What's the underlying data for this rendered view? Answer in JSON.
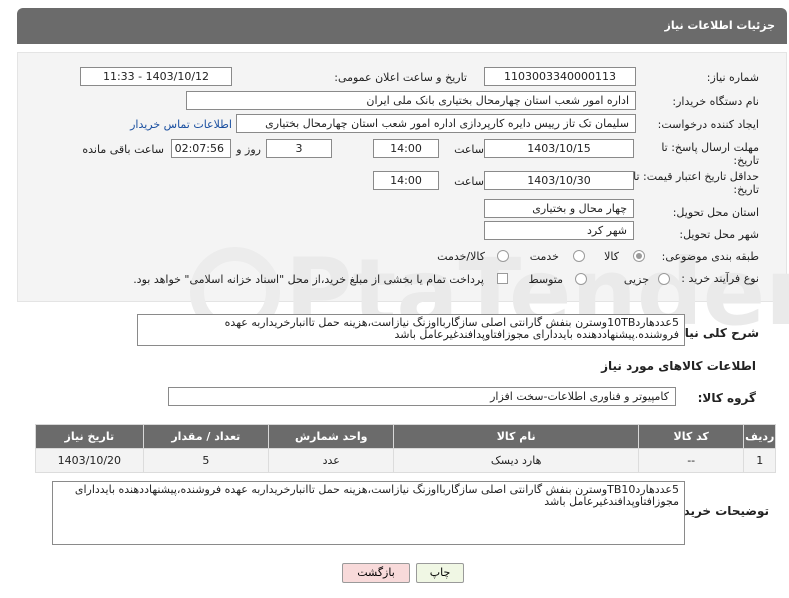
{
  "header": {
    "title": "جزئیات اطلاعات نیاز"
  },
  "form": {
    "need_number": {
      "label": "شماره نیاز:",
      "value": "1103003340000113"
    },
    "announce_datetime": {
      "label": "تاریخ و ساعت اعلان عمومی:",
      "value": "1403/10/12 - 11:33"
    },
    "buyer_org": {
      "label": "نام دستگاه خریدار:",
      "value": "اداره امور شعب استان چهارمحال بختیاری بانک ملی ایران"
    },
    "requester": {
      "label": "ایجاد کننده درخواست:",
      "value": "سلیمان تک تاز رییس دایره کارپردازی  اداره امور شعب استان چهارمحال بختیاری",
      "contact_link": "اطلاعات تماس خریدار"
    },
    "reply_deadline": {
      "label": "مهلت ارسال پاسخ: تا تاریخ:",
      "date": "1403/10/15",
      "time_label": "ساعت",
      "time": "14:00",
      "days": "3",
      "days_label": "روز و",
      "remaining": "02:07:56",
      "remaining_label": "ساعت باقی مانده"
    },
    "price_validity": {
      "label": "حداقل تاریخ اعتبار قیمت: تا تاریخ:",
      "date": "1403/10/30",
      "time_label": "ساعت",
      "time": "14:00"
    },
    "delivery_province": {
      "label": "استان محل تحویل:",
      "value": "چهار محال و بختیاری"
    },
    "delivery_city": {
      "label": "شهر محل تحویل:",
      "value": "شهر کرد"
    },
    "category": {
      "label": "طبقه بندی موضوعی:",
      "options": [
        "کالا",
        "خدمت",
        "کالا/خدمت"
      ],
      "selected": "کالا"
    },
    "purchase_type": {
      "label": "نوع فرآیند خرید :",
      "options": [
        "جزیی",
        "متوسط"
      ],
      "note": "پرداخت تمام یا بخشی از مبلغ خرید،از محل \"اسناد خزانه اسلامی\" خواهد بود."
    },
    "description": {
      "label": "شرح کلی نیاز:",
      "value": "5عددهارد10TBوسترن بنفش گارانتی اصلی سازگاربااوزنگ نیازاست،هزینه حمل تاانبارخریداربه عهده فروشنده.پیشنهاددهنده بایددارای مجوزافتاوپدافندغیرعامل باشد"
    }
  },
  "goods": {
    "section_title": "اطلاعات کالاهای مورد نیاز",
    "group_label": "گروه کالا:",
    "group_value": "کامپیوتر و فناوری اطلاعات-سخت افزار",
    "columns": [
      "ردیف",
      "کد کالا",
      "نام کالا",
      "واحد شمارش",
      "تعداد / مقدار",
      "تاریخ نیاز"
    ],
    "rows": [
      {
        "row": "1",
        "code": "--",
        "name": "هارد دیسک",
        "unit": "عدد",
        "qty": "5",
        "date": "1403/10/20"
      }
    ]
  },
  "buyer_notes": {
    "label": "توضیحات خریدار:",
    "value": "5عددهاردTB10وسترن بنفش گارانتی اصلی سازگاربااوزنگ نیازاست،هزینه حمل تاانبارخریداربه عهده فروشنده،پیشنهاددهنده بایددارای مجوزافتاوپدافندغیرعامل باشد"
  },
  "buttons": {
    "print": "چاپ",
    "back": "بازگشت"
  },
  "colors": {
    "header": "#6b6b6b",
    "back_button": "#f8dada",
    "print_button": "#f0f7e4"
  }
}
